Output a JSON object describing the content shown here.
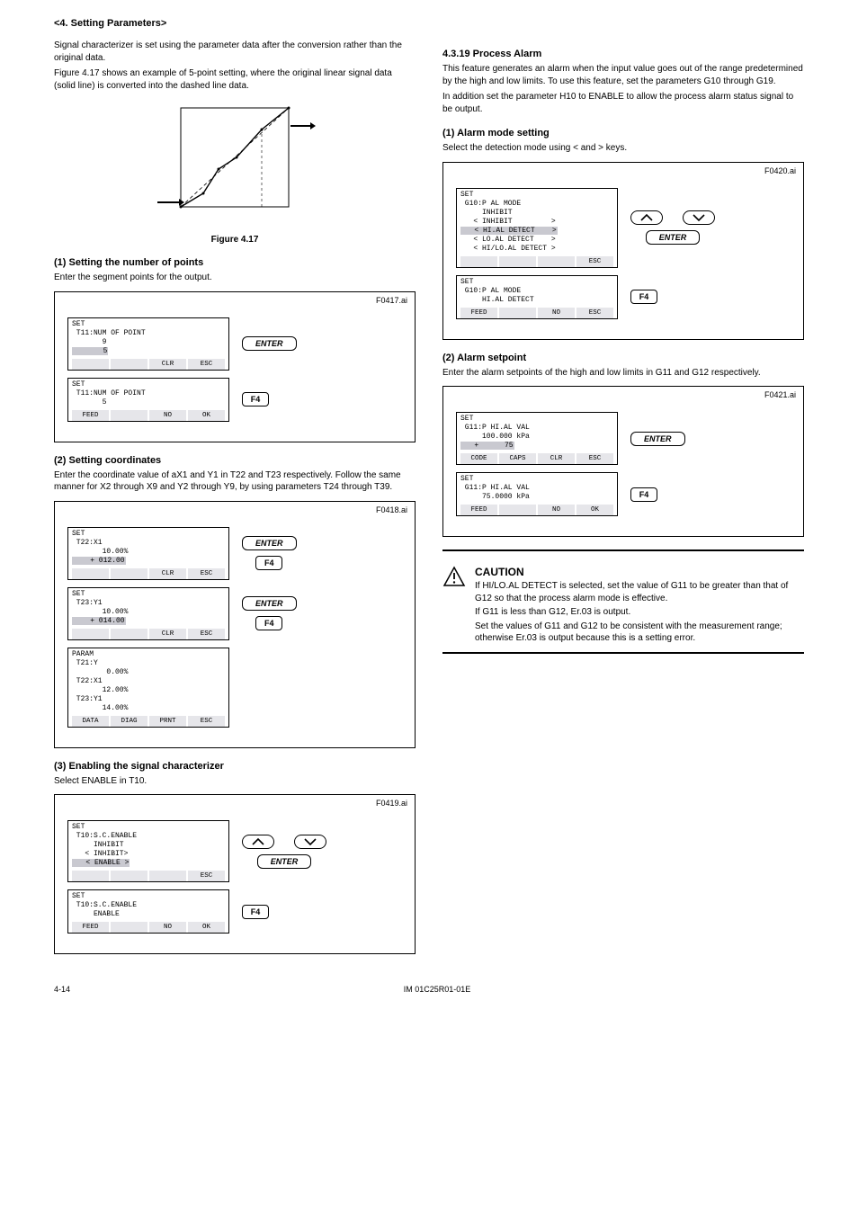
{
  "header": {
    "title": "<4. Setting Parameters>"
  },
  "intro": {
    "p1": "Signal characterizer is set using the parameter data after the conversion rather than the original data.",
    "p2": "Figure 4.17 shows an example of 5-point setting, where the original linear signal data (solid line) is converted into the dashed line data.",
    "figcap": "Figure 4.17"
  },
  "left": {
    "sec1_title": "(1) Setting the number of points",
    "sec1_p": "Enter the segment points for the output.",
    "step1": {
      "num": "F0417.ai",
      "lcd1": {
        "l1": "SET",
        "l2": " T11:NUM OF POINT",
        "l3": "       9",
        "l4": "       5"
      },
      "soft1": [
        "",
        "",
        "CLR",
        "ESC"
      ],
      "lcd2": {
        "l1": "SET",
        "l2": " T11:NUM OF POINT",
        "l3": "       5",
        "l4": ""
      },
      "soft2": [
        "FEED",
        "",
        "NO",
        "OK"
      ],
      "enter": "ENTER",
      "f4": "F4"
    },
    "sec2_title": "(2) Setting coordinates",
    "sec2_p": "Enter the coordinate value of aX1 and Y1 in T22 and T23 respectively. Follow the same manner for X2 through X9 and Y2 through Y9, by using parameters T24 through T39.",
    "step2": {
      "num": "F0418.ai",
      "lcd1": {
        "l1": "SET",
        "l2": " T22:X1",
        "l3": "       10.00%",
        "l4": "    + 012.00"
      },
      "soft1": [
        "",
        "",
        "CLR",
        "ESC"
      ],
      "lcd2": {
        "l1": "SET",
        "l2": " T23:Y1",
        "l3": "       10.00%",
        "l4": "    + 014.00"
      },
      "soft2": [
        "",
        "",
        "CLR",
        "ESC"
      ],
      "lcd3": {
        "l1": "PARAM",
        "l2": " T21:Y",
        "l3": "        0.00%",
        "l4": " T22:X1",
        "l5": "       12.00%",
        "l6": " T23:Y1",
        "l7": "       14.00%"
      },
      "soft3": [
        "DATA",
        "DIAG",
        "PRNT",
        "ESC"
      ],
      "enter": "ENTER",
      "f4": "F4"
    },
    "sec3_title": "(3) Enabling the signal characterizer",
    "sec3_p": "Select ENABLE in T10.",
    "step3": {
      "num": "F0419.ai",
      "lcd1": {
        "l1": "SET",
        "l2": " T10:S.C.ENABLE",
        "l3": "     INHIBIT",
        "l4": "   < INHIBIT>",
        "l5": "   < ENABLE >"
      },
      "soft1": [
        "",
        "",
        "",
        "ESC"
      ],
      "lcd2": {
        "l1": "SET",
        "l2": " T10:S.C.ENABLE",
        "l3": "     ENABLE",
        "l4": ""
      },
      "soft2": [
        "FEED",
        "",
        "NO",
        "OK"
      ],
      "enter": "ENTER",
      "f4": "F4"
    }
  },
  "right": {
    "sec1_title": "4.3.19 Process Alarm",
    "sec1_p1": "This feature generates an alarm when the input value goes out of the range predetermined by the high and low limits. To use this feature, set the parameters G10 through G19.",
    "sec1_p2": "In addition set the parameter H10 to ENABLE to allow the process alarm status signal to be output.",
    "sub1_title": "(1) Alarm mode setting",
    "sub1_p": "Select the detection mode using < and > keys.",
    "step1": {
      "num": "F0420.ai",
      "lcd1": {
        "l1": "SET",
        "l2": " G10:P AL MODE",
        "l3": "     INHIBIT",
        "l4": "   < INHIBIT         >",
        "l5": "   < HI.AL DETECT    >",
        "l6": "   < LO.AL DETECT    >",
        "l7": "   < HI/LO.AL DETECT >"
      },
      "soft1": [
        "",
        "",
        "",
        "ESC"
      ],
      "lcd2": {
        "l1": "SET",
        "l2": " G10:P AL MODE",
        "l3": "     HI.AL DETECT",
        "l4": ""
      },
      "soft2": [
        "FEED",
        "",
        "NO",
        "ESC"
      ],
      "enter": "ENTER",
      "f4": "F4"
    },
    "sub2_title": "(2) Alarm setpoint",
    "sub2_p": "Enter the alarm setpoints of the high and low limits in G11 and G12 respectively.",
    "step2": {
      "num": "F0421.ai",
      "lcd1": {
        "l1": "SET",
        "l2": " G11:P HI.AL VAL",
        "l3": "     100.000 kPa",
        "l4": "   +      75"
      },
      "soft1": [
        "CODE",
        "CAPS",
        "CLR",
        "ESC"
      ],
      "lcd2": {
        "l1": "SET",
        "l2": " G11:P HI.AL VAL",
        "l3": "     75.0000 kPa",
        "l4": ""
      },
      "soft2": [
        "FEED",
        "",
        "NO",
        "OK"
      ],
      "enter": "ENTER",
      "f4": "F4"
    },
    "caution": {
      "title": "CAUTION",
      "p1": "If HI/LO.AL DETECT is selected, set the value of G11 to be greater than that of G12 so that the process alarm mode is effective.",
      "p2": "If G11 is less than G12, Er.03 is output.",
      "p3": "Set the values of G11 and G12 to be consistent with the measurement range; otherwise Er.03 is output because this is a setting error."
    }
  },
  "footer": {
    "left": "4-14",
    "center": "IM 01C25R01-01E",
    "right": ""
  }
}
